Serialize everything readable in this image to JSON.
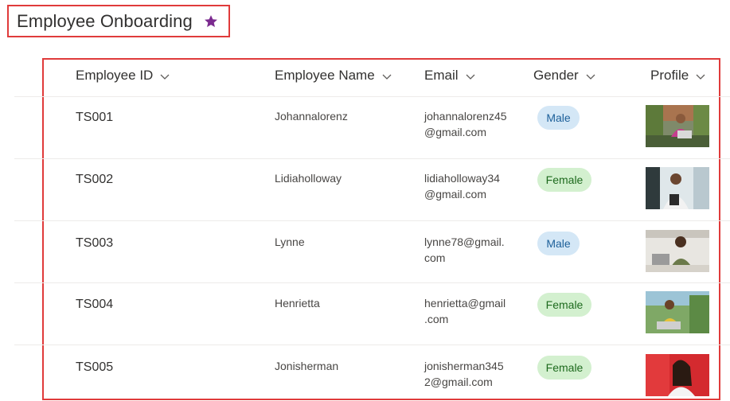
{
  "page": {
    "title": "Employee Onboarding",
    "favorite_icon": "star-icon",
    "accent_color": "#7b2a8f",
    "highlight_color": "#e03b3b"
  },
  "table": {
    "columns": [
      {
        "label": "Employee ID",
        "icon": "chevron-down-icon"
      },
      {
        "label": "Employee Name",
        "icon": "chevron-down-icon"
      },
      {
        "label": "Email",
        "icon": "chevron-down-icon"
      },
      {
        "label": "Gender",
        "icon": "chevron-down-icon"
      },
      {
        "label": "Profile",
        "icon": "chevron-down-icon"
      }
    ],
    "rows": [
      {
        "id": "TS001",
        "name": "Johannalorenz",
        "email_line1": "johannalorenz45",
        "email_line2": "@gmail.com",
        "gender": "Male"
      },
      {
        "id": "TS002",
        "name": "Lidiaholloway",
        "email_line1": "lidiaholloway34",
        "email_line2": "@gmail.com",
        "gender": "Female"
      },
      {
        "id": "TS003",
        "name": "Lynne",
        "email_line1": "lynne78@gmail.",
        "email_line2": "com",
        "gender": "Male"
      },
      {
        "id": "TS004",
        "name": "Henrietta",
        "email_line1": "henrietta@gmail",
        "email_line2": ".com",
        "gender": "Female"
      },
      {
        "id": "TS005",
        "name": "Jonisherman",
        "email_line1": "jonisherman345",
        "email_line2": "2@gmail.com",
        "gender": "Female"
      }
    ],
    "badge_colors": {
      "male_bg": "#d4e7f6",
      "male_text": "#1c5f99",
      "female_bg": "#d3f0cf",
      "female_text": "#1e6a1e"
    }
  }
}
